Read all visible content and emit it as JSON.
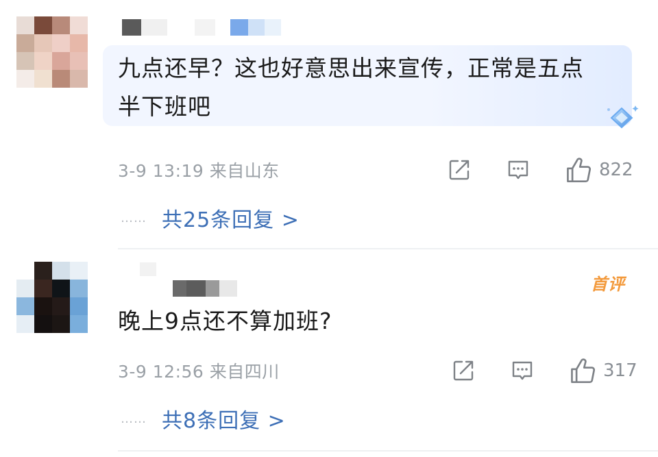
{
  "comments": [
    {
      "text": "九点还早？这也好意思出来宣传，正常是五点半下班吧",
      "line1": "九点还早？这也好意思出来宣传，正常是五点",
      "line2": "半下班吧",
      "meta": "3-9 13:19 来自山东",
      "likes": "822",
      "replies": "共25条回复 >",
      "icons": [
        "share-icon",
        "comment-icon",
        "like-icon",
        "gem-badge-icon"
      ]
    },
    {
      "text": "晚上9点还不算加班?",
      "meta": "3-9 12:56 来自四川",
      "likes": "317",
      "replies": "共8条回复 >",
      "badge": "首评",
      "icons": [
        "share-icon",
        "comment-icon",
        "like-icon"
      ]
    }
  ],
  "dots": "……",
  "colors": {
    "link": "#3d6fb6",
    "meta": "#9aa0a6",
    "badge": "#f39a3c",
    "bubble": "#f2f6ff"
  }
}
